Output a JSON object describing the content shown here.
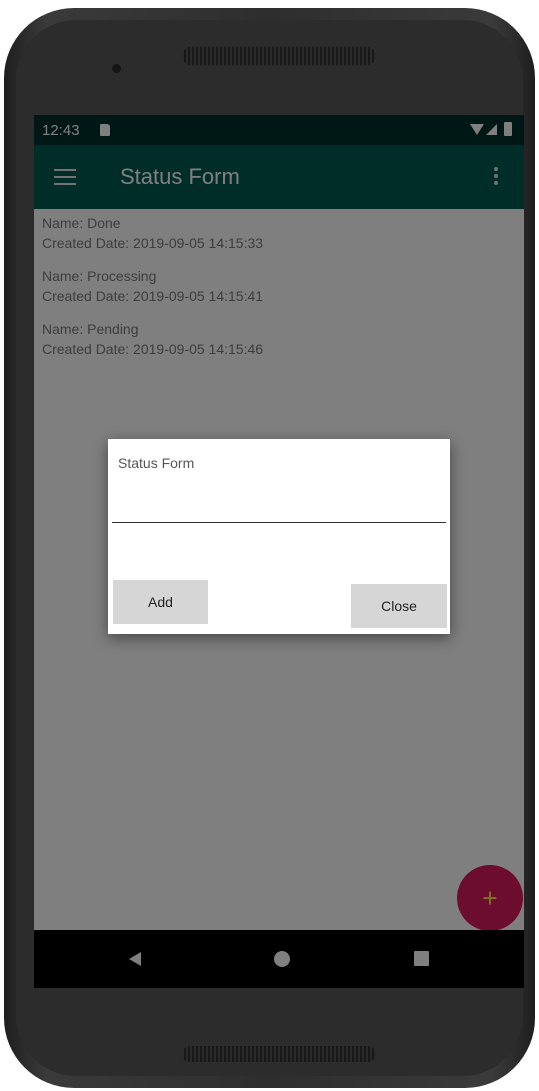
{
  "status_bar": {
    "time": "12:43",
    "icons": [
      "sd-card-icon",
      "wifi-icon",
      "signal-icon",
      "battery-icon"
    ]
  },
  "toolbar": {
    "title": "Status Form",
    "menu_icon": "hamburger-menu-icon",
    "overflow_icon": "more-vert-icon",
    "color": "#005b4f"
  },
  "statuses": [
    {
      "name": "Name: Done",
      "created": "Created Date: 2019-09-05 14:15:33"
    },
    {
      "name": "Name: Processing",
      "created": "Created Date: 2019-09-05 14:15:41"
    },
    {
      "name": "Name: Pending",
      "created": "Created Date: 2019-09-05 14:15:46"
    }
  ],
  "dialog": {
    "title": "Status Form",
    "input_value": "",
    "add_label": "Add",
    "close_label": "Close"
  },
  "fab": {
    "icon": "plus-icon",
    "symbol": "+",
    "color": "#d81b60"
  },
  "nav_bar": {
    "icons": [
      "back-icon",
      "home-icon",
      "recents-icon"
    ]
  }
}
